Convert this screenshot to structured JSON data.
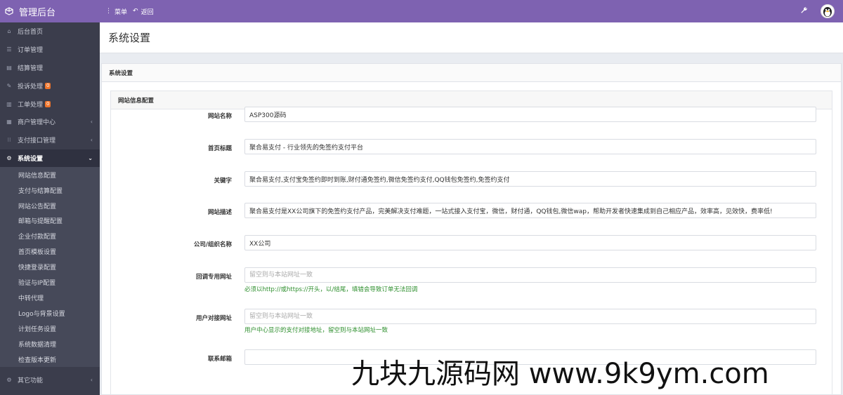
{
  "topbar": {
    "brand": "管理后台",
    "menu_label": "菜单",
    "back_label": "返回"
  },
  "sidebar": {
    "items": [
      {
        "label": "后台首页",
        "icon": "home-icon"
      },
      {
        "label": "订单管理",
        "icon": "list-icon"
      },
      {
        "label": "结算管理",
        "icon": "money-icon"
      },
      {
        "label": "投诉处理",
        "icon": "edit-icon",
        "badge": "0"
      },
      {
        "label": "工单处理",
        "icon": "ticket-icon",
        "badge": "0"
      },
      {
        "label": "商户管理中心",
        "icon": "users-icon"
      },
      {
        "label": "支付接口管理",
        "icon": "grid-icon"
      },
      {
        "label": "系统设置",
        "icon": "gear-icon"
      }
    ],
    "subitems": [
      "网站信息配置",
      "支付与结算配置",
      "网站公告配置",
      "邮箱与提醒配置",
      "企业付款配置",
      "首页模板设置",
      "快捷登录配置",
      "验证与IP配置",
      "中转代理",
      "Logo与背景设置",
      "计划任务设置",
      "系统数据清理",
      "检查版本更新"
    ],
    "bottom": {
      "label": "其它功能",
      "icon": "cogs-icon"
    }
  },
  "main": {
    "page_title": "系统设置",
    "panel_title": "系统设置",
    "section_title": "网站信息配置",
    "fields": [
      {
        "label": "网站名称",
        "value": "ASP300源码",
        "placeholder": ""
      },
      {
        "label": "首页标题",
        "value": "聚合易支付 - 行业领先的免签约支付平台",
        "placeholder": ""
      },
      {
        "label": "关键字",
        "value": "聚合易支付,支付宝免签约即时到账,财付通免签约,微信免签约支付,QQ钱包免签约,免签约支付",
        "placeholder": ""
      },
      {
        "label": "网站描述",
        "value": "聚合易支付是XX公司旗下的免签约支付产品，完美解决支付难题，一站式接入支付宝，微信，财付通，QQ钱包,微信wap，帮助开发者快速集成到自己相应产品，效率高，见效快，费率低!",
        "placeholder": ""
      },
      {
        "label": "公司/组织名称",
        "value": "XX公司",
        "placeholder": ""
      },
      {
        "label": "回调专用网址",
        "value": "",
        "placeholder": "留空则与本站网址一致",
        "hint": "必须以http://或https://开头，以/结尾，填错会导致订单无法回调"
      },
      {
        "label": "用户对接网址",
        "value": "",
        "placeholder": "留空则与本站网址一致",
        "hint": "用户中心显示的支付对接地址，留空则与本站网址一致"
      },
      {
        "label": "联系邮箱",
        "value": "",
        "placeholder": ""
      }
    ]
  },
  "watermark": "九块九源码网 www.9k9ym.com"
}
